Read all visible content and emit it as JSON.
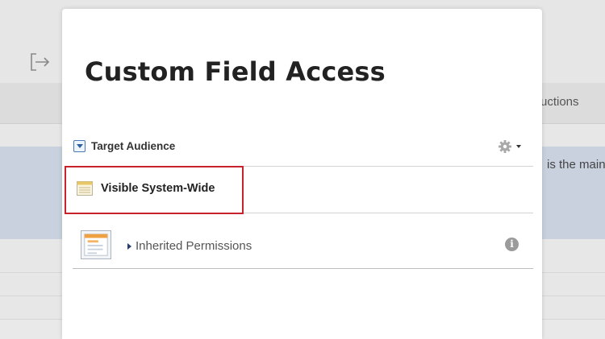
{
  "background": {
    "column_header": "uctions",
    "cell_text": "is the main"
  },
  "modal": {
    "title": "Custom Field Access",
    "section": {
      "label": "Target Audience",
      "toggle_icon": "collapse-triangle-icon",
      "menu_icon": "gear-icon"
    },
    "rows": {
      "visible": {
        "label": "Visible System-Wide",
        "icon": "table-icon"
      },
      "inherited": {
        "label": "Inherited Permissions",
        "icon": "info-icon",
        "info_glyph": "i"
      }
    }
  },
  "colors": {
    "highlight": "#c8232c",
    "toggle_accent": "#2f5f9e"
  }
}
